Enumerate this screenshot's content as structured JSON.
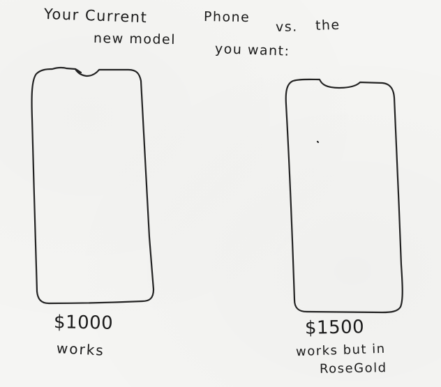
{
  "title": {
    "words": [
      "Your Current",
      "Phone",
      "vs.",
      "the",
      "new model",
      "you want:"
    ]
  },
  "left_phone": {
    "price": "$1000",
    "note": "works"
  },
  "right_phone": {
    "price": "$1500",
    "note_line1": "works but in",
    "note_line2": "RoseGold"
  }
}
